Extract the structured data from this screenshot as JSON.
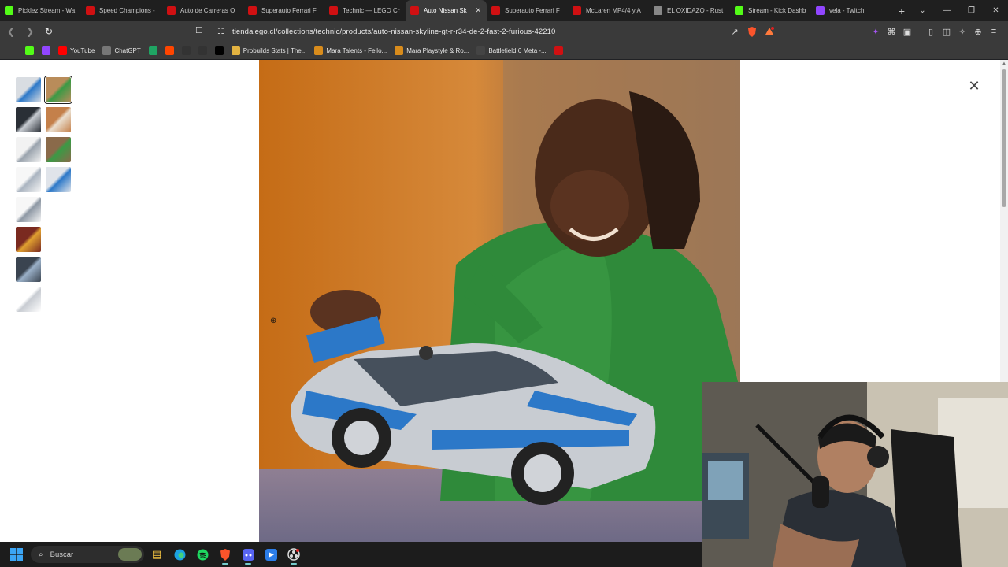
{
  "browser": {
    "tabs": [
      {
        "title": "Picklez Stream - Wa",
        "icon": "kick-icon",
        "color": "#53fc18",
        "active": false
      },
      {
        "title": "Speed Champions -",
        "icon": "lego-icon",
        "color": "#d01012",
        "active": false
      },
      {
        "title": "Auto de Carreras O",
        "icon": "lego-icon",
        "color": "#d01012",
        "active": false
      },
      {
        "title": "Superauto Ferrari F",
        "icon": "lego-icon",
        "color": "#d01012",
        "active": false
      },
      {
        "title": "Technic — LEGO Ch",
        "icon": "lego-icon",
        "color": "#d01012",
        "active": false
      },
      {
        "title": "Auto Nissan Sk",
        "icon": "lego-icon",
        "color": "#d01012",
        "active": true
      },
      {
        "title": "Superauto Ferrari F",
        "icon": "lego-icon",
        "color": "#d01012",
        "active": false
      },
      {
        "title": "McLaren MP4/4 y A",
        "icon": "lego-icon",
        "color": "#d01012",
        "active": false
      },
      {
        "title": "EL OXIDAZO - Rust",
        "icon": "globe-icon",
        "color": "#888888",
        "active": false
      },
      {
        "title": "Stream - Kick Dashb",
        "icon": "kick-icon",
        "color": "#53fc18",
        "active": false
      },
      {
        "title": "vela - Twitch",
        "icon": "twitch-icon",
        "color": "#9146ff",
        "active": false
      }
    ],
    "new_tab_label": "+",
    "url": "tiendalego.cl/collections/technic/products/auto-nissan-skyline-gt-r-r34-de-2-fast-2-furious-42210",
    "bookmarks": [
      {
        "label": "",
        "icon": "apps-icon",
        "color": "#3a3a3a"
      },
      {
        "label": "",
        "icon": "kick-icon",
        "color": "#53fc18"
      },
      {
        "label": "",
        "icon": "twitch-icon",
        "color": "#9146ff"
      },
      {
        "label": "YouTube",
        "icon": "youtube-icon",
        "color": "#ff0000"
      },
      {
        "label": "ChatGPT",
        "icon": "chatgpt-icon",
        "color": "#777777"
      },
      {
        "label": "",
        "icon": "sheets-icon",
        "color": "#1fa463"
      },
      {
        "label": "",
        "icon": "reddit-icon",
        "color": "#ff4500"
      },
      {
        "label": "",
        "icon": "flickr-icon",
        "color": "#333333"
      },
      {
        "label": "",
        "icon": "github-icon",
        "color": "#333333"
      },
      {
        "label": "",
        "icon": "x-icon",
        "color": "#000000"
      },
      {
        "label": "Probuilds Stats | The...",
        "icon": "probuilds-icon",
        "color": "#e3b341"
      },
      {
        "label": "Mara Talents - Fello...",
        "icon": "mara-icon",
        "color": "#d98c1c"
      },
      {
        "label": "Mara Playstyle & Ro...",
        "icon": "mara-icon",
        "color": "#d98c1c"
      },
      {
        "label": "Battlefield 6 Meta -...",
        "icon": "battlefield-icon",
        "color": "#444444"
      },
      {
        "label": "",
        "icon": "mi-icon",
        "color": "#d01012"
      }
    ]
  },
  "gallery": {
    "thumb_count": 12,
    "selected_index": 1
  },
  "taskbar": {
    "search_placeholder": "Buscar"
  }
}
